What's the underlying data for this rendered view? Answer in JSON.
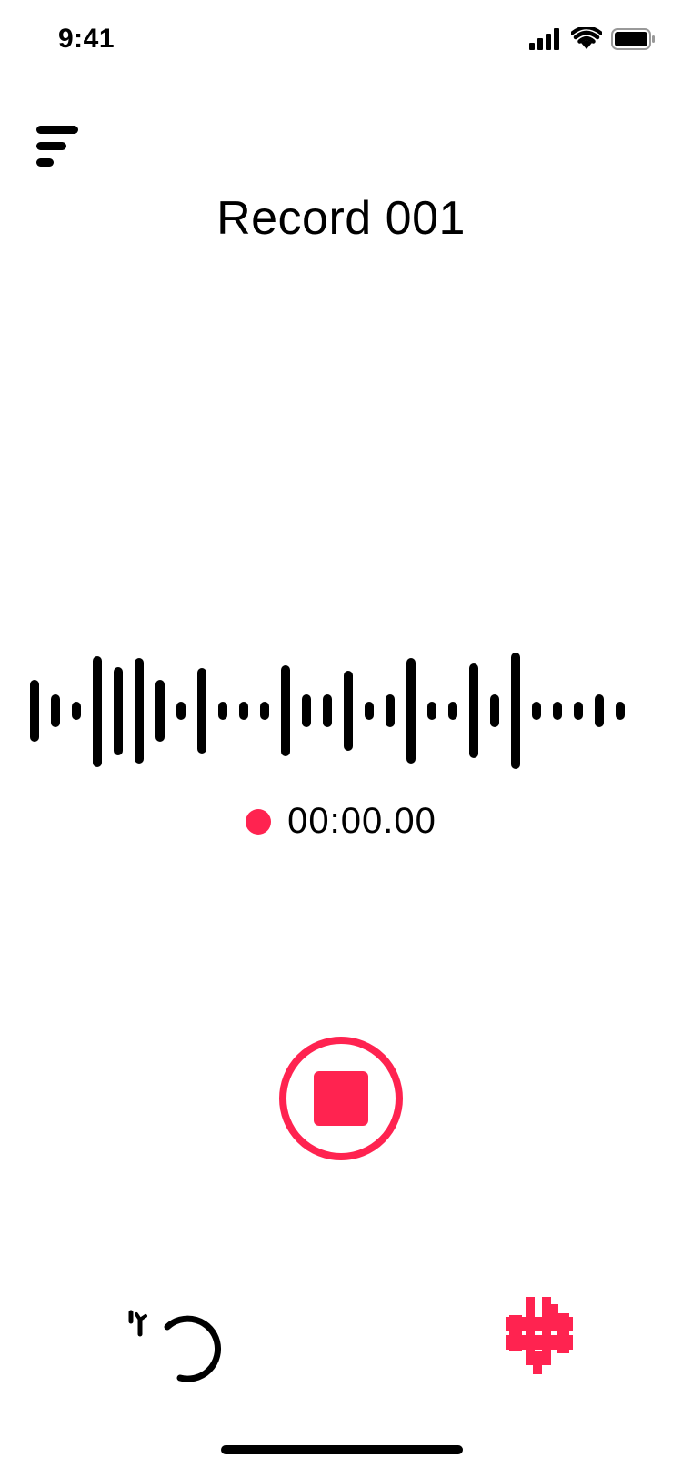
{
  "status_bar": {
    "time": "9:41"
  },
  "header": {
    "title": "Record 001"
  },
  "recording": {
    "elapsed": "00:00.00",
    "state": "recording"
  },
  "colors": {
    "accent": "#ff2350",
    "text": "#000000",
    "background": "#ffffff"
  },
  "icons": {
    "menu": "menu-icon",
    "stop": "stop-icon",
    "undo": "undo-icon",
    "flag": "flag-icon",
    "signal": "signal-icon",
    "wifi": "wifi-icon",
    "battery": "battery-icon"
  }
}
